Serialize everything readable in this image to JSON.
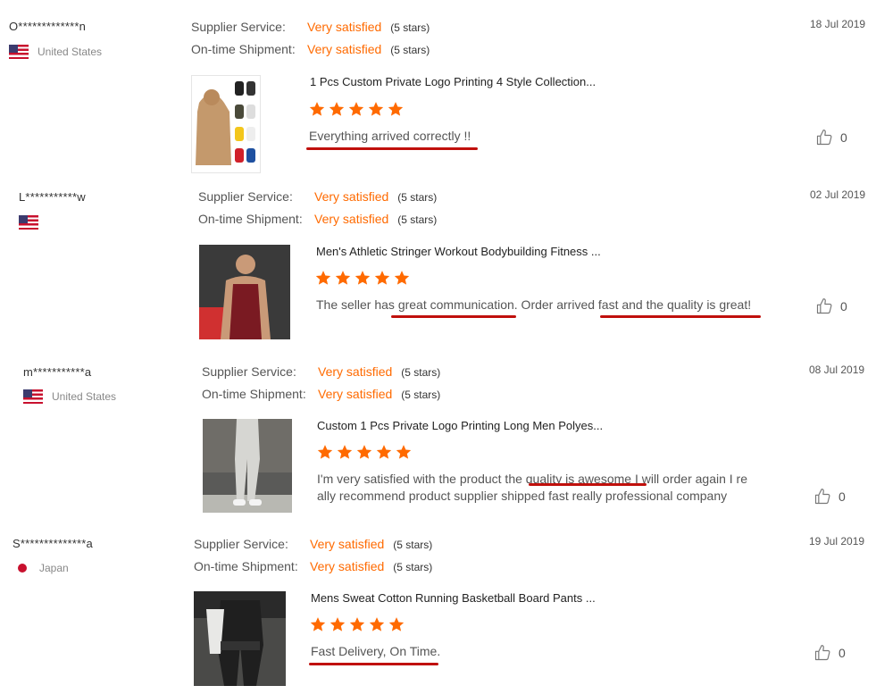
{
  "labels": {
    "supplier_service": "Supplier Service:",
    "on_time_shipment": "On-time Shipment:",
    "very_satisfied": "Very satisfied",
    "five_stars": "(5 stars)"
  },
  "colors": {
    "accent": "#ff6a00",
    "underline": "#c0100c",
    "star": "#ff6a00"
  },
  "icons": {
    "like": "thumbs-up-icon",
    "star": "star-icon"
  },
  "reviews": [
    {
      "buyer": "O*************n",
      "country": "United States",
      "flag": "us",
      "date": "18 Jul 2019",
      "product_title": "1 Pcs Custom Private Logo Printing 4 Style Collection...",
      "rating_stars": 5,
      "comment": "Everything arrived correctly !!",
      "likes": "0"
    },
    {
      "buyer": "L***********w",
      "country": "",
      "flag": "us",
      "date": "02 Jul 2019",
      "product_title": "Men's Athletic Stringer Workout Bodybuilding Fitness ...",
      "rating_stars": 5,
      "comment": "The seller has great communication. Order arrived fast and the quality is great!",
      "likes": "0"
    },
    {
      "buyer": "m***********a",
      "country": "United States",
      "flag": "us",
      "date": "08 Jul 2019",
      "product_title": "Custom 1 Pcs Private Logo Printing Long Men Polyes...",
      "rating_stars": 5,
      "comment_line1": "I'm very satisfied with the product the quality is awesome I will order again I re",
      "comment_line2": "ally recommend product supplier shipped fast really professional company",
      "likes": "0"
    },
    {
      "buyer": "S**************a",
      "country": "Japan",
      "flag": "jp",
      "date": "19 Jul 2019",
      "product_title": "Mens Sweat Cotton Running Basketball Board Pants ...",
      "rating_stars": 5,
      "comment": "Fast Delivery, On Time.",
      "likes": "0"
    }
  ]
}
